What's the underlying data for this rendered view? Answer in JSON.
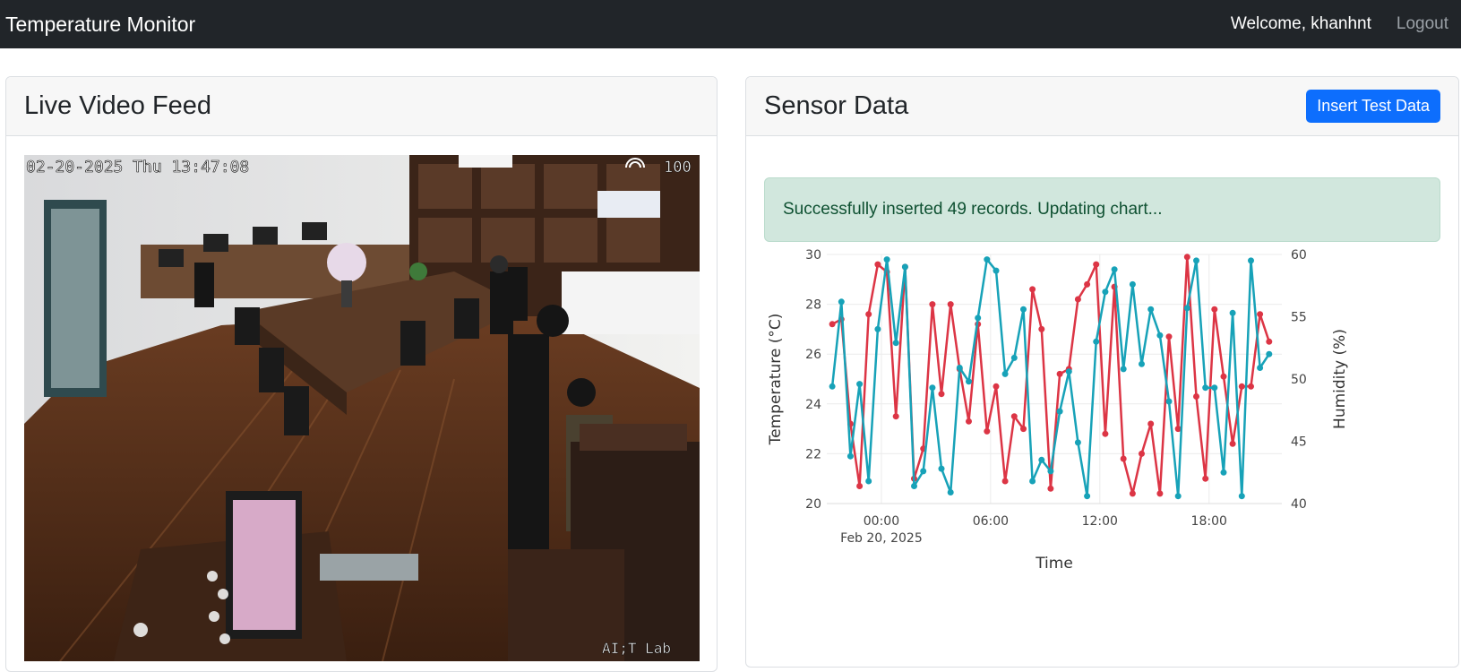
{
  "navbar": {
    "brand": "Temperature Monitor",
    "welcome": "Welcome, khanhnt",
    "logout": "Logout"
  },
  "video": {
    "title": "Live Video Feed",
    "overlay_timestamp": "02-20-2025 Thu 13:47:08",
    "overlay_channel": "100",
    "overlay_watermark": "AI;T Lab"
  },
  "sensor": {
    "title": "Sensor Data",
    "insert_button": "Insert Test Data",
    "alert_message": "Successfully inserted 49 records. Updating chart..."
  },
  "colors": {
    "navbar": "#212529",
    "primary": "#0d6efd",
    "alert_bg": "#d1e7dd",
    "alert_text": "#0f5132",
    "temperature_line": "#dc3545",
    "humidity_line": "#17a2b8"
  },
  "chart_data": {
    "type": "line",
    "title": "",
    "xlabel": "Time",
    "ylabel": "Temperature (°C)",
    "y2label": "Humidity (%)",
    "ylim": [
      20,
      30
    ],
    "y2lim": [
      40,
      60
    ],
    "yticks": [
      "20",
      "22",
      "24",
      "26",
      "28",
      "30"
    ],
    "y2ticks": [
      "40",
      "45",
      "50",
      "55",
      "60"
    ],
    "xticks": [
      {
        "hours": 0,
        "label": "00:00",
        "sublabel": "Feb 20, 2025"
      },
      {
        "hours": 6,
        "label": "06:00",
        "sublabel": ""
      },
      {
        "hours": 12,
        "label": "12:00",
        "sublabel": ""
      },
      {
        "hours": 18,
        "label": "18:00",
        "sublabel": ""
      }
    ],
    "x_hours": [
      -2.7,
      -2.2,
      -1.7,
      -1.2,
      -0.7,
      -0.2,
      0.3,
      0.8,
      1.3,
      1.8,
      2.3,
      2.8,
      3.3,
      3.8,
      4.3,
      4.8,
      5.3,
      5.8,
      6.3,
      6.8,
      7.3,
      7.8,
      8.3,
      8.8,
      9.3,
      9.8,
      10.3,
      10.8,
      11.3,
      11.8,
      12.3,
      12.8,
      13.3,
      13.8,
      14.3,
      14.8,
      15.3,
      15.8,
      16.3,
      16.8,
      17.3,
      17.8,
      18.3,
      18.8,
      19.3,
      19.8,
      20.3,
      20.8,
      21.3
    ],
    "series": [
      {
        "name": "Temperature",
        "axis": "left",
        "values": [
          27.2,
          27.4,
          23.2,
          20.7,
          27.6,
          29.6,
          29.3,
          23.5,
          29.5,
          21.0,
          22.2,
          28.0,
          24.4,
          28.0,
          25.4,
          23.3,
          27.2,
          22.9,
          24.7,
          20.9,
          23.5,
          23.0,
          28.6,
          27.0,
          20.6,
          25.2,
          25.4,
          28.2,
          28.8,
          29.6,
          22.8,
          28.7,
          21.8,
          20.4,
          22.0,
          23.2,
          20.4,
          26.7,
          23.0,
          29.9,
          24.3,
          21.0,
          27.8,
          25.1,
          22.4,
          24.7,
          24.7,
          27.6,
          26.5
        ],
        "color": "#dc3545"
      },
      {
        "name": "Humidity",
        "axis": "right",
        "values": [
          49.4,
          56.2,
          43.8,
          49.6,
          41.8,
          54.0,
          59.6,
          52.9,
          59.0,
          41.4,
          42.6,
          49.3,
          42.8,
          40.9,
          50.9,
          49.8,
          54.9,
          59.6,
          58.7,
          50.4,
          51.7,
          55.6,
          41.8,
          43.5,
          42.6,
          47.4,
          50.6,
          44.9,
          40.6,
          53.0,
          57.0,
          58.8,
          50.8,
          57.6,
          51.2,
          55.6,
          53.5,
          48.2,
          40.6,
          55.7,
          59.5,
          49.3,
          49.3,
          42.5,
          55.3,
          40.6,
          59.5,
          50.9,
          52.0
        ],
        "color": "#17a2b8"
      }
    ],
    "grid": true,
    "legend": "none"
  }
}
